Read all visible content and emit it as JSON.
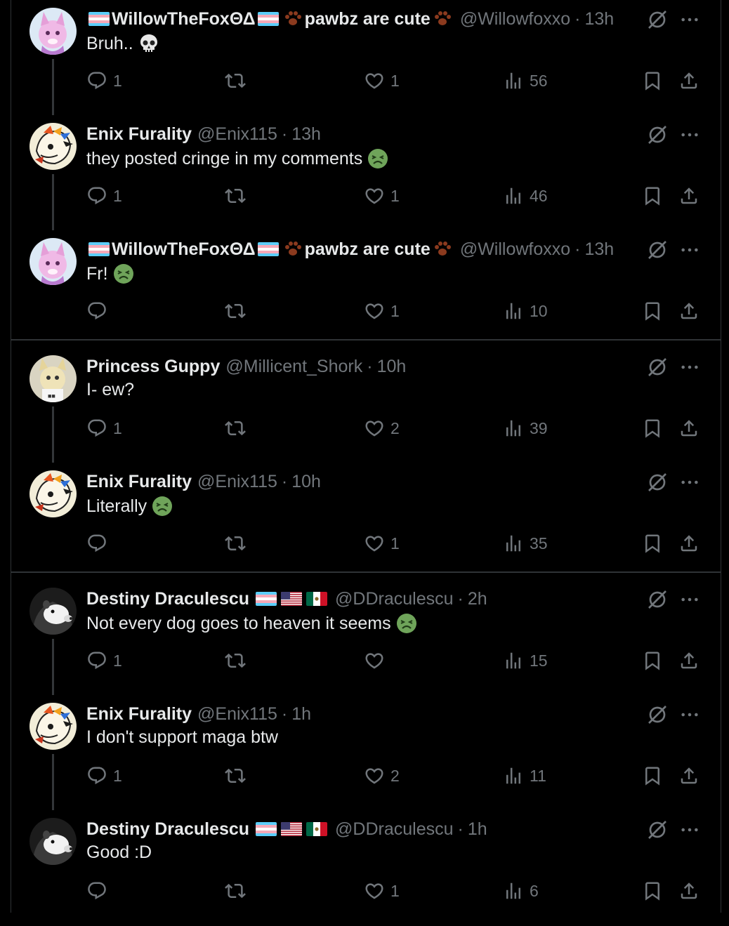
{
  "tweets": [
    {
      "name": "WillowTheFoxΘΔ",
      "name_suffix": "pawbz are cute",
      "handle": "@Willowfoxxo",
      "time": "13h",
      "text": "Bruh..",
      "emoji": "skull",
      "avatar": "pink-fox",
      "flags": [
        "trans"
      ],
      "paws": true,
      "replies": "1",
      "likes": "1",
      "views": "56",
      "thread_line": true
    },
    {
      "name": "Enix Furality",
      "name_suffix": "",
      "handle": "@Enix115",
      "time": "13h",
      "text": "they posted cringe in my comments",
      "emoji": "nauseated",
      "avatar": "dragon",
      "flags": [],
      "paws": false,
      "replies": "1",
      "likes": "1",
      "views": "46",
      "thread_line": true
    },
    {
      "name": "WillowTheFoxΘΔ",
      "name_suffix": "pawbz are cute",
      "handle": "@Willowfoxxo",
      "time": "13h",
      "text": "Fr!",
      "emoji": "nauseated",
      "avatar": "pink-fox",
      "flags": [
        "trans"
      ],
      "paws": true,
      "replies": "",
      "likes": "1",
      "views": "10",
      "thread_line": false
    },
    {
      "name": "Princess Guppy",
      "name_suffix": "",
      "handle": "@Millicent_Shork",
      "time": "10h",
      "text": "I- ew?",
      "emoji": "",
      "avatar": "cream-cat",
      "flags": [],
      "paws": false,
      "replies": "1",
      "likes": "2",
      "views": "39",
      "thread_line": true
    },
    {
      "name": "Enix Furality",
      "name_suffix": "",
      "handle": "@Enix115",
      "time": "10h",
      "text": "Literally",
      "emoji": "nauseated",
      "avatar": "dragon",
      "flags": [],
      "paws": false,
      "replies": "",
      "likes": "1",
      "views": "35",
      "thread_line": false
    },
    {
      "name": "Destiny Draculescu",
      "name_suffix": "",
      "handle": "@DDraculescu",
      "time": "2h",
      "text": "Not every dog goes to heaven it seems",
      "emoji": "nauseated",
      "avatar": "opossum",
      "flags": [
        "trans",
        "us",
        "mx"
      ],
      "paws": false,
      "replies": "1",
      "likes": "",
      "views": "15",
      "thread_line": true
    },
    {
      "name": "Enix Furality",
      "name_suffix": "",
      "handle": "@Enix115",
      "time": "1h",
      "text": "I don't support maga btw",
      "emoji": "",
      "avatar": "dragon",
      "flags": [],
      "paws": false,
      "replies": "1",
      "likes": "2",
      "views": "11",
      "thread_line": true
    },
    {
      "name": "Destiny Draculescu",
      "name_suffix": "",
      "handle": "@DDraculescu",
      "time": "1h",
      "text": "Good :D",
      "emoji": "",
      "avatar": "opossum",
      "flags": [
        "trans",
        "us",
        "mx"
      ],
      "paws": false,
      "replies": "",
      "likes": "1",
      "views": "6",
      "thread_line": false
    }
  ],
  "colors": {
    "background": "#000000",
    "text": "#e7e9ea",
    "muted": "#71767b",
    "border": "#2f3336",
    "nausea_green": "#6fa45a"
  },
  "icons": {
    "reply": "reply-icon",
    "retweet": "retweet-icon",
    "like": "heart-icon",
    "views": "views-icon",
    "bookmark": "bookmark-icon",
    "share": "share-icon",
    "grok": "grok-icon",
    "more": "more-icon"
  }
}
